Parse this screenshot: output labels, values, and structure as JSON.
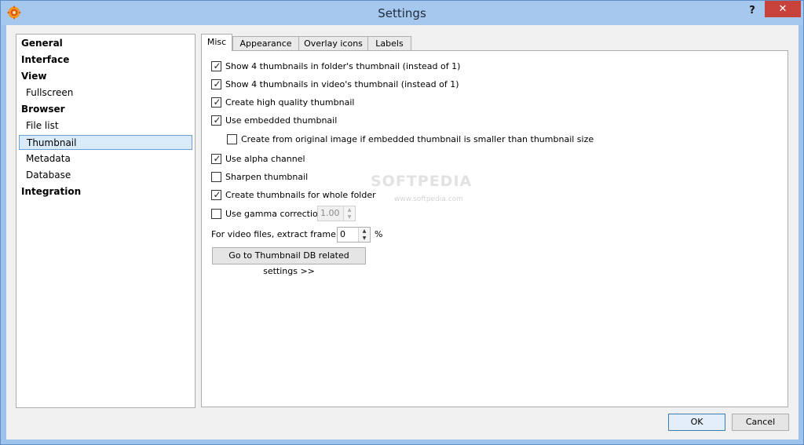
{
  "window": {
    "title": "Settings",
    "help_label": "?",
    "close_label": "✕",
    "app_icon": "gear-flower-icon"
  },
  "nav": {
    "items": [
      {
        "label": "General",
        "kind": "category"
      },
      {
        "label": "Interface",
        "kind": "category"
      },
      {
        "label": "View",
        "kind": "category"
      },
      {
        "label": "Fullscreen",
        "kind": "sub"
      },
      {
        "label": "Browser",
        "kind": "category"
      },
      {
        "label": "File list",
        "kind": "sub"
      },
      {
        "label": "Thumbnail",
        "kind": "sub",
        "selected": true
      },
      {
        "label": "Metadata",
        "kind": "sub"
      },
      {
        "label": "Database",
        "kind": "sub"
      },
      {
        "label": "Integration",
        "kind": "category"
      }
    ]
  },
  "tabs": [
    {
      "label": "Misc",
      "active": true
    },
    {
      "label": "Appearance"
    },
    {
      "label": "Overlay icons"
    },
    {
      "label": "Labels"
    }
  ],
  "options": [
    {
      "label": "Show 4 thumbnails in folder's thumbnail (instead of 1)",
      "checked": true
    },
    {
      "label": "Show 4 thumbnails in video's thumbnail (instead of 1)",
      "checked": true
    },
    {
      "label": "Create high quality thumbnail",
      "checked": true
    },
    {
      "label": "Use embedded thumbnail",
      "checked": true
    },
    {
      "label": "Create from original image if embedded thumbnail is smaller than thumbnail size",
      "checked": false
    },
    {
      "label": "Use alpha channel",
      "checked": true
    },
    {
      "label": "Sharpen thumbnail",
      "checked": false
    },
    {
      "label": "Create  thumbnails for whole folder",
      "checked": true
    },
    {
      "label": "Use gamma correction",
      "checked": false
    }
  ],
  "gamma": {
    "value": "1.00",
    "enabled": false
  },
  "video_frame": {
    "label": "For video files, extract frame at",
    "value": "0",
    "unit": "%"
  },
  "goto_button": {
    "label": "Go to Thumbnail DB related settings >>"
  },
  "footer": {
    "ok_label": "OK",
    "cancel_label": "Cancel"
  },
  "watermark": {
    "text": "SOFTPEDIA",
    "sub": "www.softpedia.com"
  },
  "colors": {
    "selection_bg": "#d9ebf9",
    "selection_border": "#6ea0d6",
    "close_button": "#c7423a",
    "frame": "#a6c8ee"
  }
}
